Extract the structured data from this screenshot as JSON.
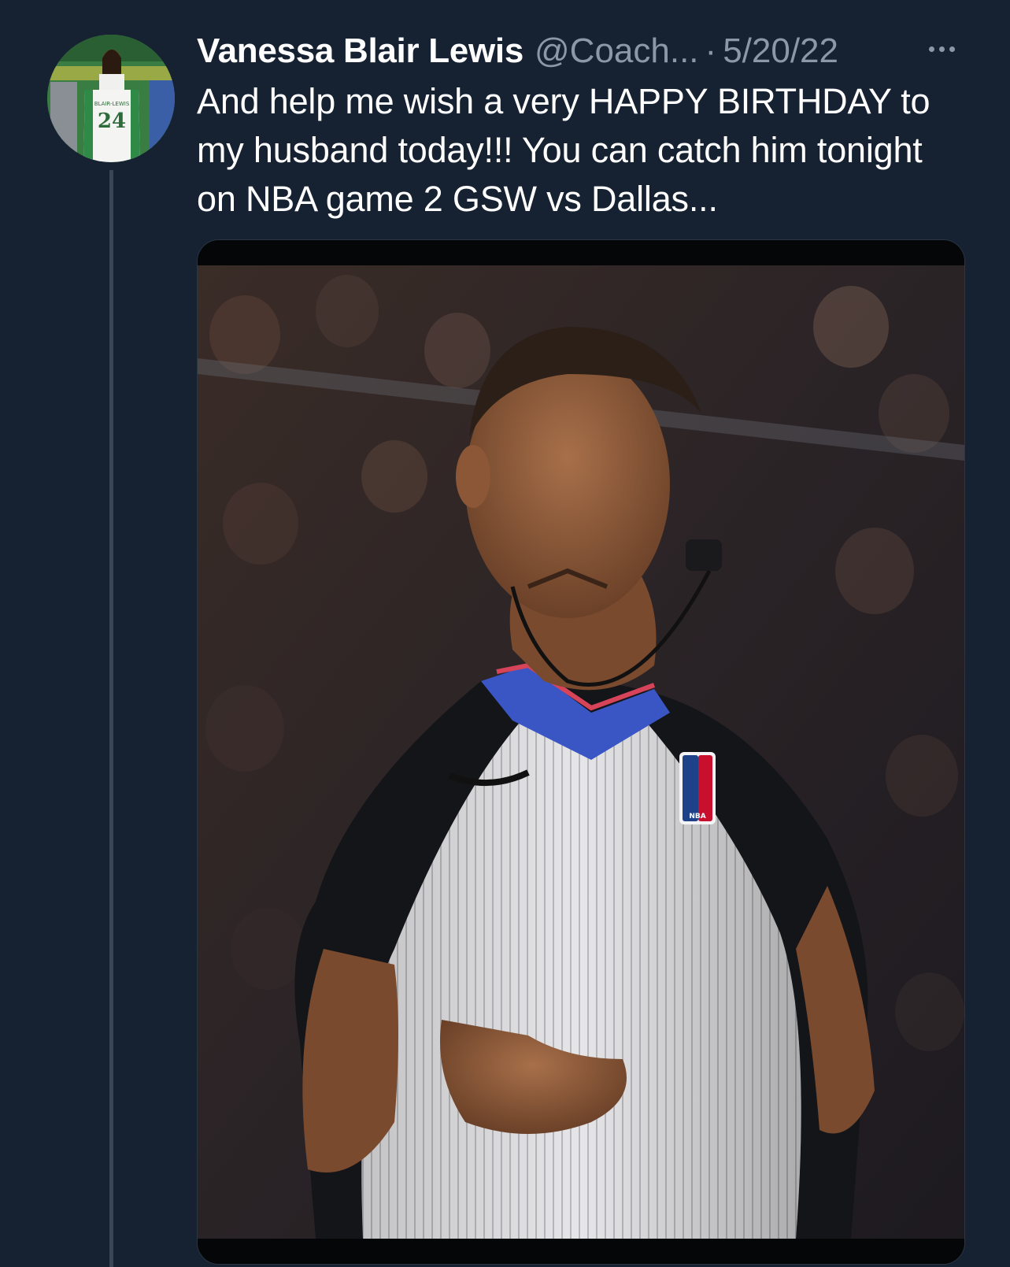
{
  "tweet": {
    "author_name": "Vanessa Blair Lewis",
    "author_handle": "@Coach...",
    "separator": "·",
    "date": "5/20/22",
    "text": "And help me wish a very HAPPY BIRTHDAY to my husband today!!! You can catch him tonight on NBA game 2 GSW vs Dallas...",
    "more_icon": "more-horizontal-icon"
  },
  "avatar": {
    "jersey_number": "24",
    "jersey_name": "BLAIR-LEWIS"
  },
  "media": {
    "logo_text": "NBA"
  },
  "colors": {
    "background": "#162231",
    "text_primary": "#ffffff",
    "text_secondary": "#8b98a5",
    "thread_line": "#3a4653"
  }
}
